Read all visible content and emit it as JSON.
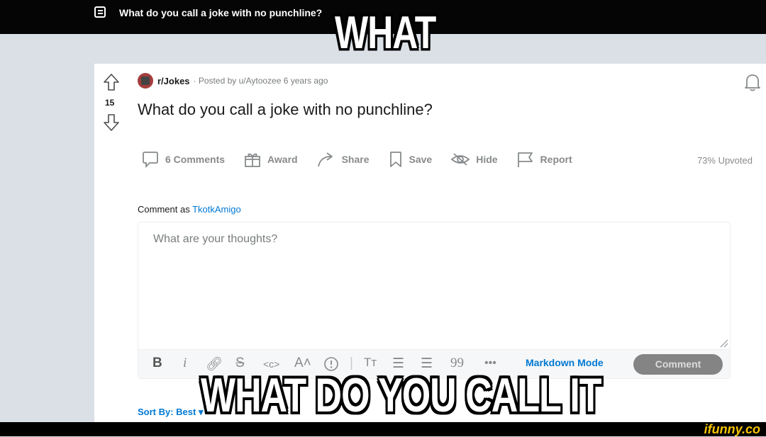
{
  "header": {
    "title": "What do you call a joke with no punchline?"
  },
  "meme": {
    "top": "WHAT",
    "bottom": "WHAT DO YOU CALL IT"
  },
  "post": {
    "votes": "15",
    "subreddit": "r/Jokes",
    "meta": "· Posted by u/Aytoozee 6 years ago",
    "title": "What do you call a joke with no punchline?",
    "upvoted": "73% Upvoted"
  },
  "actions": {
    "comments": "6 Comments",
    "award": "Award",
    "share": "Share",
    "save": "Save",
    "hide": "Hide",
    "report": "Report"
  },
  "comment_box": {
    "label": "Comment as",
    "user": "TkotkAmigo",
    "placeholder": "What are your thoughts?",
    "markdown_mode": "Markdown Mode",
    "submit": "Comment"
  },
  "sort": {
    "label": "Sort By: Best"
  },
  "watermark": "ifunny.co",
  "colors": {
    "accent": "#0079d3",
    "top_bar": "#050505",
    "background": "#dae0e6",
    "watermark": "#f5c400"
  }
}
